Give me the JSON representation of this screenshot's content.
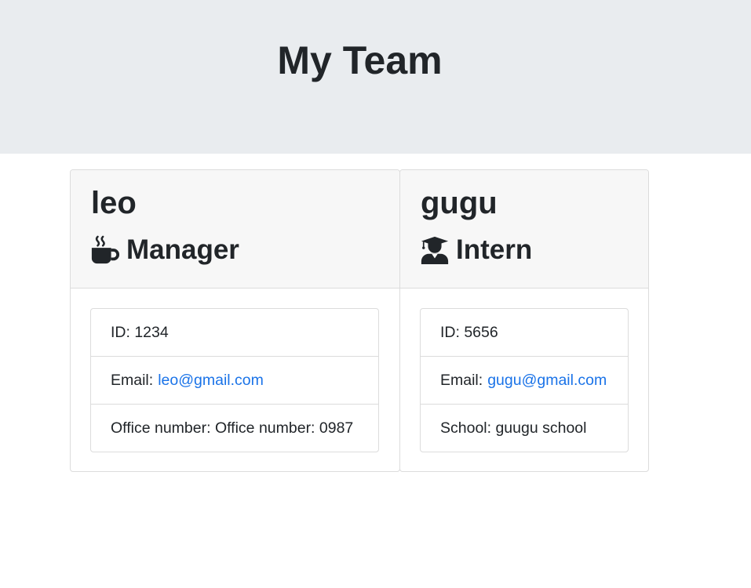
{
  "header": {
    "title": "My Team"
  },
  "team": [
    {
      "name": "leo",
      "role": "Manager",
      "role_icon": "mug-hot-icon",
      "id_text": "ID: 1234",
      "email_label": "Email:",
      "email": "leo@gmail.com",
      "extra_text": "Office number: Office number: 0987"
    },
    {
      "name": "gugu",
      "role": "Intern",
      "role_icon": "user-graduate-icon",
      "id_text": "ID: 5656",
      "email_label": "Email:",
      "email": "gugu@gmail.com",
      "extra_text": "School: guugu school"
    }
  ],
  "colors": {
    "header_bg": "#e9ecef",
    "card_header_bg": "#f7f7f7",
    "link": "#1a73e8",
    "text": "#212529"
  }
}
